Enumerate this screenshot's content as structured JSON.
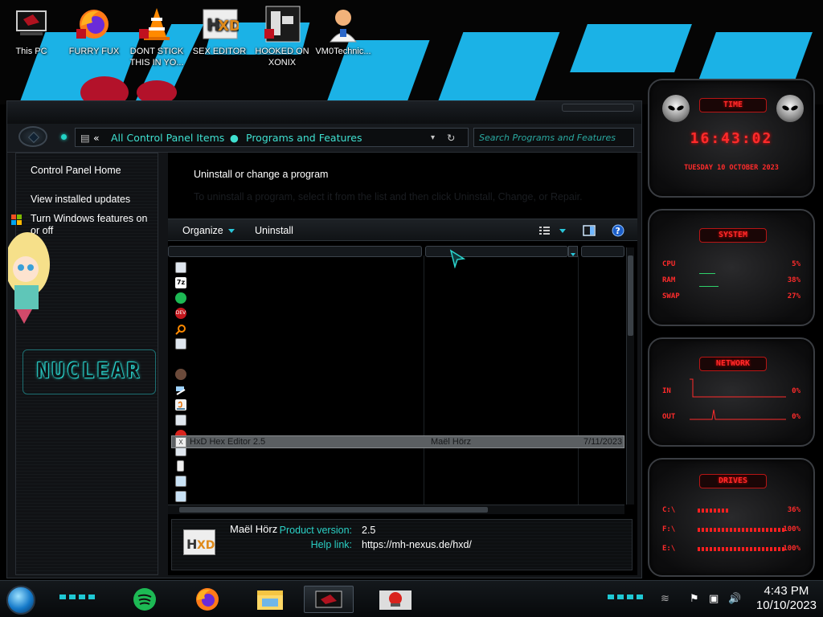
{
  "desktop": {
    "icons": [
      {
        "label": "This PC",
        "icon": "computer-icon"
      },
      {
        "label": "FURRY FUX",
        "icon": "firefox-icon"
      },
      {
        "label": "DONT STICK THIS IN YO...",
        "icon": "vlc-cone-icon"
      },
      {
        "label": "SEX EDITOR",
        "icon": "hxd-icon"
      },
      {
        "label": "HOOKED ON XONIX",
        "icon": "game-icon"
      },
      {
        "label": "VM0Technic...",
        "icon": "doctor-avatar-icon"
      }
    ]
  },
  "window": {
    "breadcrumb": [
      "All Control Panel Items",
      "Programs and Features"
    ],
    "search_placeholder": "Search Programs and Features",
    "sidebar": {
      "links": [
        "Control Panel Home",
        "View installed updates",
        "Turn Windows features on or off"
      ],
      "logo_text": "NUCLEAR"
    },
    "heading": "Uninstall or change a program",
    "subheading": "To uninstall a program, select it from the list and then click Uninstall, Change, or Repair.",
    "toolbar": {
      "organize": "Organize",
      "uninstall": "Uninstall"
    },
    "selected_program": {
      "name": "HxD Hex Editor 2.5",
      "publisher": "Maël Hörz",
      "installed_on": "7/11/2023"
    },
    "details": {
      "publisher": "Maël Hörz",
      "product_version_label": "Product version:",
      "product_version": "2.5",
      "help_link_label": "Help link:",
      "help_link": "https://mh-nexus.de/hxd/"
    }
  },
  "gadgets": {
    "time": {
      "title": "TIME",
      "clock": "16:43:02",
      "date": "TUESDAY 10 OCTOBER 2023"
    },
    "system": {
      "title": "SYSTEM",
      "rows": [
        {
          "label": "CPU",
          "value": "5%"
        },
        {
          "label": "RAM",
          "value": "38%"
        },
        {
          "label": "SWAP",
          "value": "27%"
        }
      ]
    },
    "network": {
      "title": "NETWORK",
      "rows": [
        {
          "label": "IN",
          "value": "0%"
        },
        {
          "label": "OUT",
          "value": "0%"
        }
      ]
    },
    "drives": {
      "title": "DRIVES",
      "rows": [
        {
          "label": "C:\\",
          "value": "36%"
        },
        {
          "label": "F:\\",
          "value": "100%"
        },
        {
          "label": "E:\\",
          "value": "100%"
        }
      ]
    }
  },
  "taskbar": {
    "apps": [
      "spotify-icon",
      "firefox-icon",
      "file-explorer-icon",
      "control-panel-icon",
      "media-icon"
    ],
    "clock_time": "4:43 PM",
    "clock_date": "10/10/2023"
  },
  "colors": {
    "accent": "#2ad0c5",
    "gadget_red": "#ff2b2b",
    "wallpaper_blue": "#1bb2e6"
  }
}
